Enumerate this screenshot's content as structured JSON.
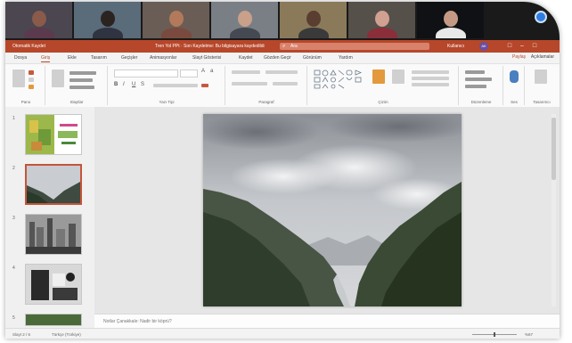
{
  "titlebar": {
    "autosave": "Otomatik Kaydet",
    "doc_title": "Tren Yol PPt · Son Kaydetme: Bu bilgisayara kaydedildi",
    "search_placeholder": "Ara",
    "user_name": "Kullanıcı",
    "avatar_initials": "AK"
  },
  "tabs": [
    {
      "label": "Dosya"
    },
    {
      "label": "Giriş"
    },
    {
      "label": "Ekle"
    },
    {
      "label": "Tasarım"
    },
    {
      "label": "Geçişler"
    },
    {
      "label": "Animasyonlar"
    },
    {
      "label": "Slayt Gösterisi"
    },
    {
      "label": "Kaydet"
    },
    {
      "label": "Gözden Geçir"
    },
    {
      "label": "Görünüm"
    },
    {
      "label": "Yardım"
    }
  ],
  "share_label": "Paylaş",
  "comments_label": "Açıklamalar",
  "ribbon_groups": [
    "Pano",
    "Slaytlar",
    "Yazı Tipi",
    "Paragraf",
    "Çizim",
    "Düzenleme",
    "Ses",
    "Tasarımcı"
  ],
  "notes_placeholder": "Notlar Çanakkale: Nadir bir köprü?",
  "status": {
    "slide_info": "Slayt 2 / 6",
    "language": "Türkçe (Türkiye)",
    "zoom": "%67"
  },
  "slide_numbers": [
    "1",
    "2",
    "3",
    "4",
    "5"
  ]
}
